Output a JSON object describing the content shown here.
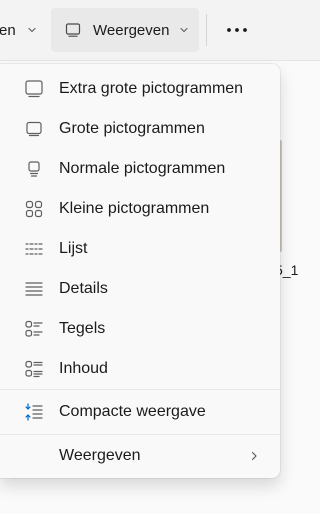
{
  "toolbar": {
    "partial_label": "en",
    "view_button_label": "Weergeven",
    "more_label": "..."
  },
  "file": {
    "caption": "5_1"
  },
  "menu": {
    "items": [
      {
        "label": "Extra grote pictogrammen",
        "icon": "extra-large-icons-icon"
      },
      {
        "label": "Grote pictogrammen",
        "icon": "large-icons-icon"
      },
      {
        "label": "Normale pictogrammen",
        "icon": "medium-icons-icon"
      },
      {
        "label": "Kleine pictogrammen",
        "icon": "small-icons-icon"
      },
      {
        "label": "Lijst",
        "icon": "list-icon"
      },
      {
        "label": "Details",
        "icon": "details-icon"
      },
      {
        "label": "Tegels",
        "icon": "tiles-icon"
      },
      {
        "label": "Inhoud",
        "icon": "content-icon"
      }
    ],
    "compact": {
      "label": "Compacte weergave",
      "icon": "compact-view-icon"
    },
    "submenu": {
      "label": "Weergeven",
      "icon": "chevron-right-icon"
    }
  },
  "colors": {
    "accent": "#0067c0",
    "icon": "#5f5f5f",
    "text": "#1b1b1b"
  }
}
